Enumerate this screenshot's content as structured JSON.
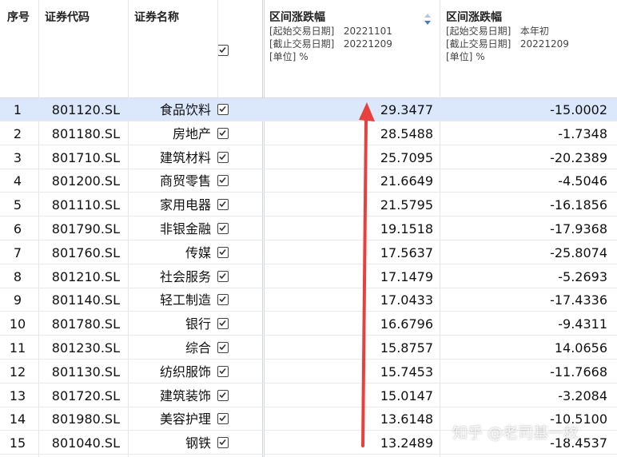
{
  "columns": {
    "index": "序号",
    "code": "证券代码",
    "name": "证券名称",
    "col1": {
      "title": "区间涨跌幅",
      "start_label": "[起始交易日期]",
      "start_value": "20221101",
      "end_label": "[截止交易日期]",
      "end_value": "20221209",
      "unit_label": "[单位]",
      "unit_value": "%"
    },
    "col2": {
      "title": "区间涨跌幅",
      "start_label": "[起始交易日期]",
      "start_value": "本年初",
      "end_label": "[截止交易日期]",
      "end_value": "20221209",
      "unit_label": "[单位]",
      "unit_value": "%"
    }
  },
  "rows": [
    {
      "idx": "1",
      "code": "801120.SL",
      "name": "食品饮料",
      "v1": "29.3477",
      "v2": "-15.0002"
    },
    {
      "idx": "2",
      "code": "801180.SL",
      "name": "房地产",
      "v1": "28.5488",
      "v2": "-1.7348"
    },
    {
      "idx": "3",
      "code": "801710.SL",
      "name": "建筑材料",
      "v1": "25.7095",
      "v2": "-20.2389"
    },
    {
      "idx": "4",
      "code": "801200.SL",
      "name": "商贸零售",
      "v1": "21.6649",
      "v2": "-4.5046"
    },
    {
      "idx": "5",
      "code": "801110.SL",
      "name": "家用电器",
      "v1": "21.5795",
      "v2": "-16.1856"
    },
    {
      "idx": "6",
      "code": "801790.SL",
      "name": "非银金融",
      "v1": "19.1518",
      "v2": "-17.9368"
    },
    {
      "idx": "7",
      "code": "801760.SL",
      "name": "传媒",
      "v1": "17.5637",
      "v2": "-25.8074"
    },
    {
      "idx": "8",
      "code": "801210.SL",
      "name": "社会服务",
      "v1": "17.1479",
      "v2": "-5.2693"
    },
    {
      "idx": "9",
      "code": "801140.SL",
      "name": "轻工制造",
      "v1": "17.0433",
      "v2": "-17.4336"
    },
    {
      "idx": "10",
      "code": "801780.SL",
      "name": "银行",
      "v1": "16.6796",
      "v2": "-9.4311"
    },
    {
      "idx": "11",
      "code": "801230.SL",
      "name": "综合",
      "v1": "15.8757",
      "v2": "14.0656"
    },
    {
      "idx": "12",
      "code": "801130.SL",
      "name": "纺织服饰",
      "v1": "15.7453",
      "v2": "-11.7668"
    },
    {
      "idx": "13",
      "code": "801720.SL",
      "name": "建筑装饰",
      "v1": "15.0147",
      "v2": "-3.2084"
    },
    {
      "idx": "14",
      "code": "801980.SL",
      "name": "美容护理",
      "v1": "13.6148",
      "v2": "-10.5100"
    },
    {
      "idx": "15",
      "code": "801040.SL",
      "name": "钢铁",
      "v1": "13.2489",
      "v2": "-18.4537"
    }
  ],
  "watermark": "知乎 @老司基一枚",
  "colors": {
    "selected_row": "#dbe7fb",
    "arrow": "#e8413d",
    "sort_icon": "#4a78c8"
  }
}
